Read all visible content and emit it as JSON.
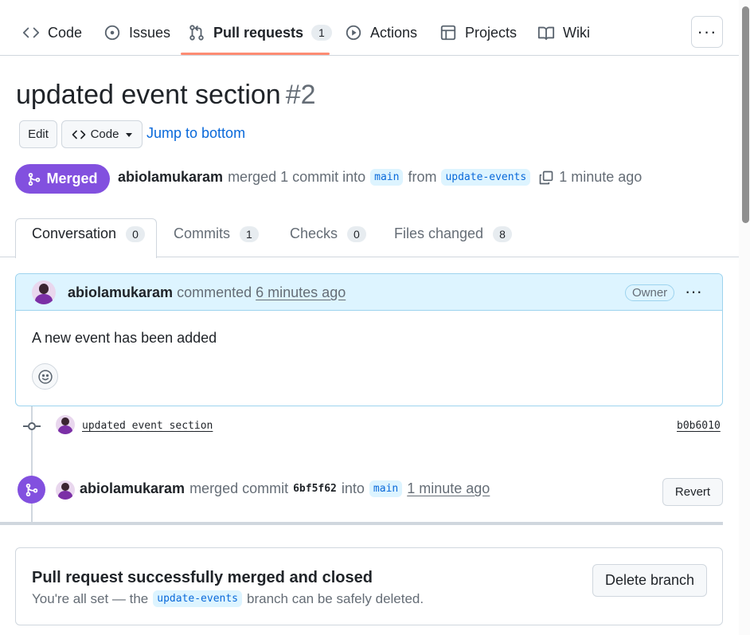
{
  "repo_nav": {
    "tabs": [
      {
        "label": "Code",
        "icon": "code-icon"
      },
      {
        "label": "Issues",
        "icon": "issue-icon"
      },
      {
        "label": "Pull requests",
        "icon": "pull-request-icon",
        "count": "1",
        "active": true
      },
      {
        "label": "Actions",
        "icon": "play-icon"
      },
      {
        "label": "Projects",
        "icon": "table-icon"
      },
      {
        "label": "Wiki",
        "icon": "book-icon"
      }
    ],
    "more_icon": "kebab-horizontal-icon"
  },
  "pr": {
    "title": "updated event section",
    "number": "#2",
    "edit_label": "Edit",
    "code_label": "Code",
    "jump_label": "Jump to bottom",
    "state_label": "Merged",
    "author": "abiolamukaram",
    "merged_text": "merged 1 commit into",
    "base_branch": "main",
    "from_text": "from",
    "head_branch": "update-events",
    "time": "1 minute ago"
  },
  "pr_tabs": [
    {
      "label": "Conversation",
      "count": "0",
      "active": true
    },
    {
      "label": "Commits",
      "count": "1"
    },
    {
      "label": "Checks",
      "count": "0"
    },
    {
      "label": "Files changed",
      "count": "8"
    }
  ],
  "comment": {
    "author": "abiolamukaram",
    "action": "commented",
    "time": "6 minutes ago",
    "role_badge": "Owner",
    "body": "A new event has been added"
  },
  "timeline": {
    "commit_message": "updated event section",
    "commit_sha": "b0b6010",
    "merge_author": "abiolamukaram",
    "merge_text": "merged commit",
    "merge_sha": "6bf5f62",
    "into_text": "into",
    "merge_branch": "main",
    "merge_time": "1 minute ago",
    "revert_label": "Revert"
  },
  "merged_box": {
    "title": "Pull request successfully merged and closed",
    "desc_before": "You're all set — the",
    "branch": "update-events",
    "desc_after": "branch can be safely deleted.",
    "delete_label": "Delete branch"
  },
  "colors": {
    "merged_purple": "#8250df",
    "link_blue": "#0969da",
    "comment_header": "#ddf4ff",
    "tab_underline": "#fd8c73"
  }
}
